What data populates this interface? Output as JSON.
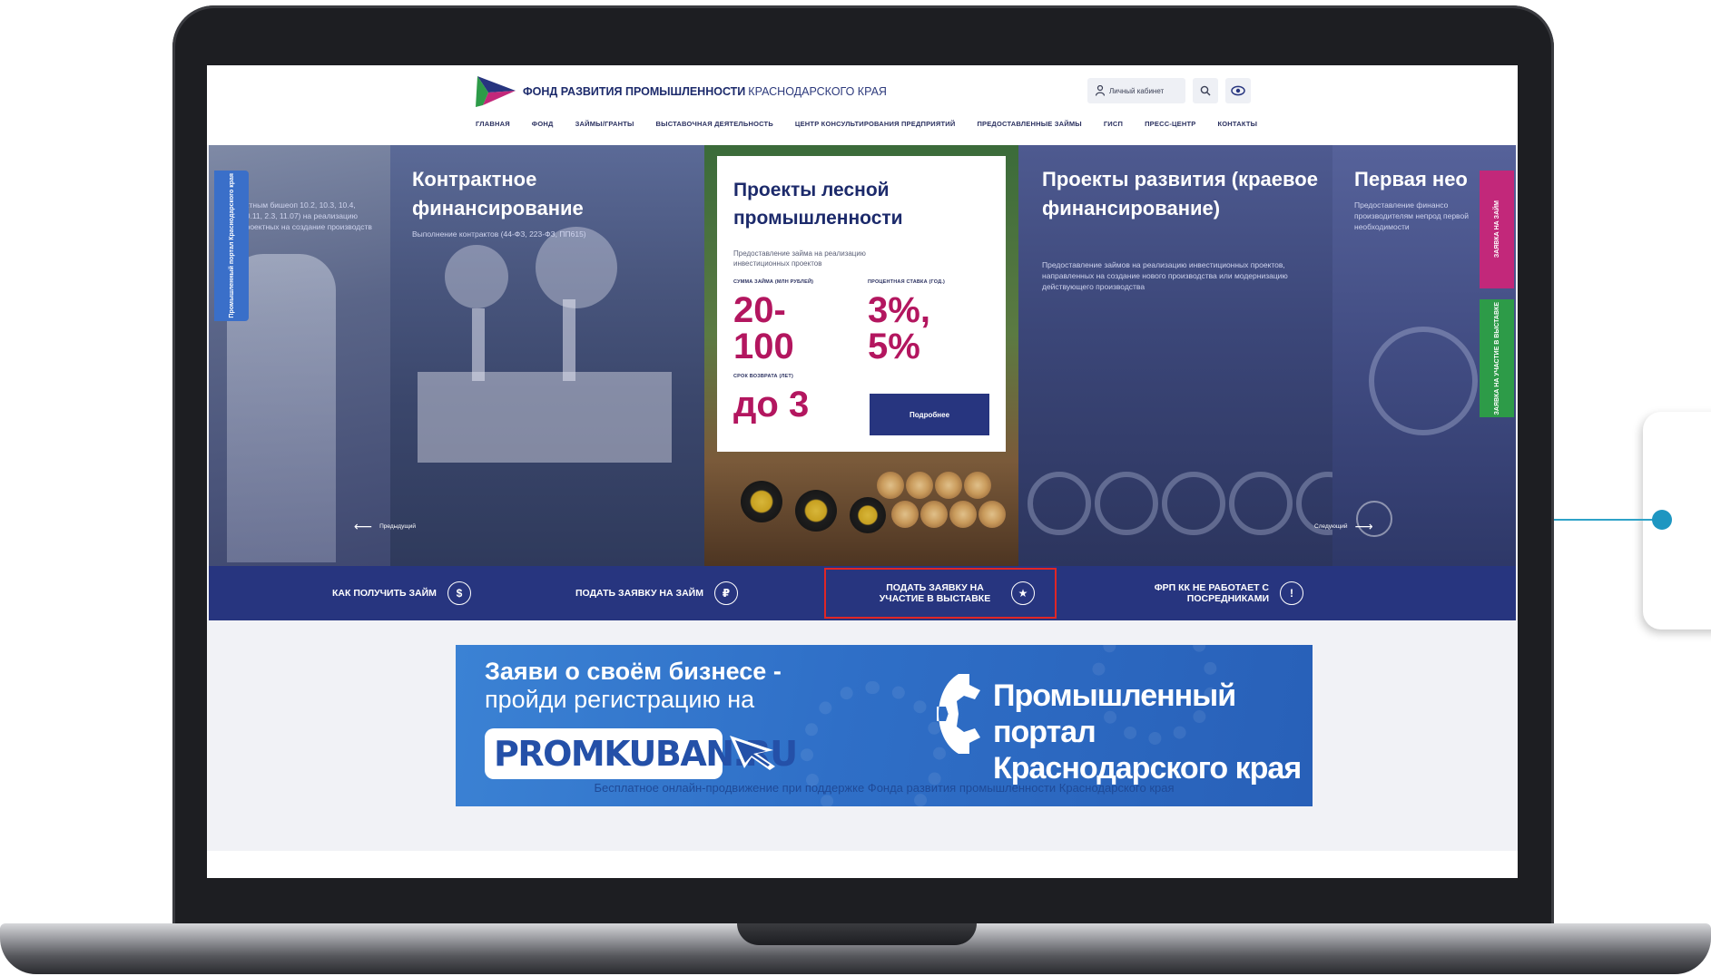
{
  "header": {
    "logo_bold": "ФОНД РАЗВИТИЯ ПРОМЫШЛЕННОСТИ",
    "logo_light": "КРАСНОДАРСКОГО КРАЯ",
    "account_label": "Личный кабинет",
    "nav": [
      "ГЛАВНАЯ",
      "ФОНД",
      "ЗАЙМЫ/ГРАНТЫ",
      "ВЫСТАВОЧНАЯ ДЕЯТЕЛЬНОСТЬ",
      "ЦЕНТР КОНСУЛЬТИРОВАНИЯ ПРЕДПРИЯТИЙ",
      "ПРЕДОСТАВЛЕННЫЕ ЗАЙМЫ",
      "ГИСП",
      "ПРЕСС-ЦЕНТР",
      "КОНТАКТЫ"
    ]
  },
  "hero": {
    "portal_tab": "Промышленный портал Краснодарского края",
    "slide0_desc": "ектным бишеоп 10.2, 10.3, 10.4, 10.11, 2.3, 11.07) на реализацию проектных на создание производств",
    "slide1": {
      "title": "Контрактное финансирование",
      "desc": "Выполнение контрактов (44-ФЗ, 223-ФЗ, ПП615)"
    },
    "slide2": {
      "title": "Проекты лесной промышленности",
      "desc": "Предоставление займа на реализацию инвестиционных проектов",
      "amount_label": "СУММА ЗАЙМА (МЛН РУБЛЕЙ)",
      "amount_value": "20-100",
      "rate_label": "ПРОЦЕНТНАЯ СТАВКА (ГОД.)",
      "rate_value": "3%, 5%",
      "term_label": "СРОК ВОЗВРАТА (ЛЕТ)",
      "term_value": "до 3",
      "more_button": "Подробнее"
    },
    "slide3": {
      "title": "Проекты развития (краевое финансирование)",
      "desc": "Предоставление займов на реализацию инвестиционных проектов, направленных на создание нового производства или модернизацию действующего производства"
    },
    "slide4": {
      "title": "Первая нео",
      "desc": "Предоставление финансо производителям непрод первой необходимости"
    },
    "tab_loan": "ЗАЯВКА НА ЗАЙМ",
    "tab_expo": "ЗАЯВКА НА УЧАСТИЕ В ВЫСТАВКЕ",
    "prev_label": "Предыдущий",
    "next_label": "Следующий"
  },
  "action_bar": [
    {
      "label": "КАК ПОЛУЧИТЬ ЗАЙМ",
      "icon": "$"
    },
    {
      "label": "ПОДАТЬ ЗАЯВКУ НА ЗАЙМ",
      "icon": "₽"
    },
    {
      "label": "ПОДАТЬ ЗАЯВКУ НА УЧАСТИЕ В ВЫСТАВКЕ",
      "icon": "★"
    },
    {
      "label": "ФРП КК НЕ РАБОТАЕТ С ПОСРЕДНИКАМИ",
      "icon": "!"
    }
  ],
  "banner": {
    "headline_1": "Заяви о своём бизнесе -",
    "headline_2": "пройди регистрацию на",
    "domain": "PROMKUBAN.RU",
    "portal_line_1": "Промышленный портал",
    "portal_line_2": "Краснодарского края",
    "footnote": "Бесплатное онлайн-продвижение при поддержке Фонда развития промышленности Краснодарского края"
  },
  "colors": {
    "brand_navy": "#27357f",
    "accent_magenta": "#b3165f",
    "tab_pink": "#c2287a",
    "tab_green": "#2d9b48",
    "highlight_red": "#e02626",
    "callout_teal": "#1e96c1"
  }
}
